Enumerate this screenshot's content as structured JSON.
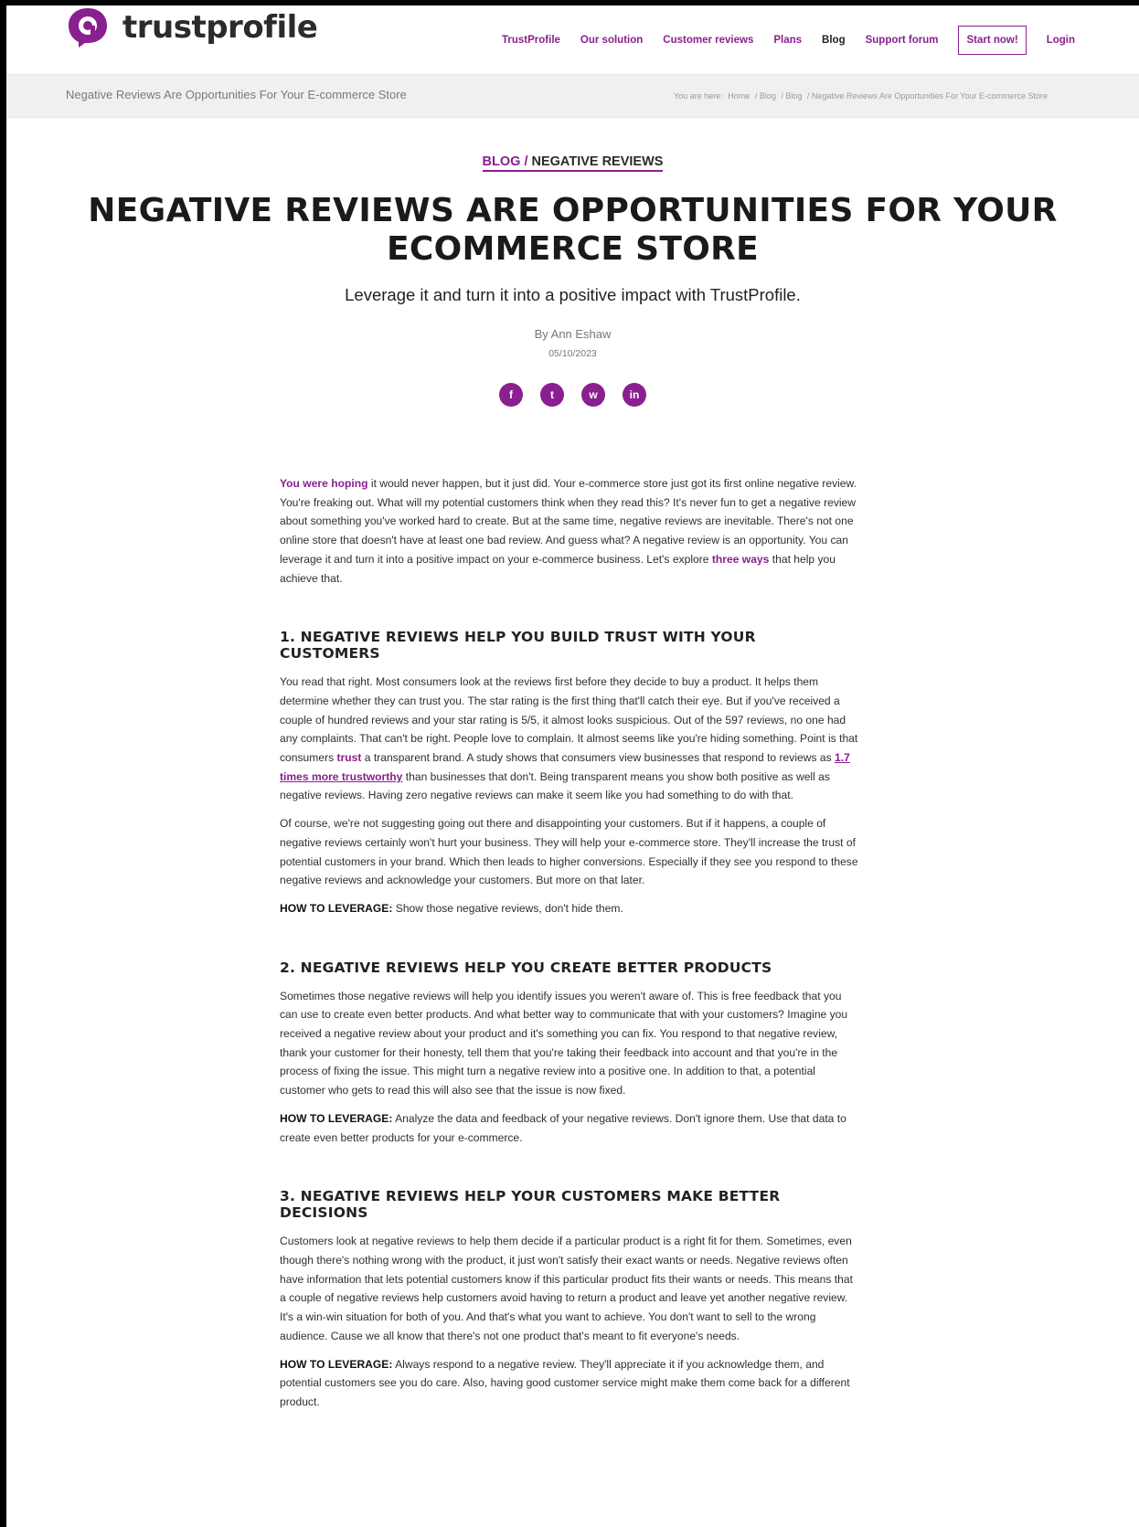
{
  "header": {
    "logo_text": "trustprofile",
    "nav": [
      "TrustProfile",
      "Our solution",
      "Customer reviews",
      "Plans",
      "Blog",
      "Support forum",
      "Start now!",
      "Login"
    ]
  },
  "subbar": {
    "title": "Negative Reviews Are Opportunities For Your E-commerce Store",
    "crumbs": [
      "You are here:",
      "Home",
      "/ Blog",
      "/ Blog",
      "/ Negative Reviews Are Opportunities For Your E-commerce Store"
    ]
  },
  "post": {
    "cat1": "BLOG /",
    "cat2": "NEGATIVE REVIEWS",
    "title": "NEGATIVE REVIEWS ARE OPPORTUNITIES FOR YOUR ECOMMERCE STORE",
    "lead": "Leverage it and turn it into a positive impact with TrustProfile.",
    "author": "By Ann Eshaw",
    "date": "05/10/2023",
    "social": [
      "f",
      "t",
      "w",
      "in"
    ]
  },
  "body": {
    "intro_hl": "You were hoping",
    "intro": " it would never happen, but it just did. Your e-commerce store just got its first online negative review. You're freaking out. What will my potential customers think when they read this? It's never fun to get a negative review about something you've worked hard to create. But at the same time, negative reviews are inevitable. There's not one online store that doesn't have at least one bad review. And guess what? A negative review is an opportunity. You can leverage it and turn it into a positive impact on your e-commerce business. Let's explore ",
    "intro_hl2": "three ways",
    "intro_end": " that help you achieve that.",
    "h1": "1. NEGATIVE REVIEWS HELP YOU BUILD TRUST WITH YOUR CUSTOMERS",
    "p1a": "You read that right. Most consumers look at the reviews first before they decide to buy a product. It helps them determine whether they can trust you. The star rating is the first thing that'll catch their eye. But if you've received a couple of hundred reviews and your star rating is 5/5, it almost looks suspicious. Out of the 597 reviews, no one had any complaints. That can't be right. People love to complain. It almost seems like you're hiding something. Point is that consumers ",
    "p1_trust": "trust",
    "p1b": " a transparent brand. A study shows that consumers view businesses that respond to reviews as ",
    "p1_link": "1.7 times more trustworthy",
    "p1c": " than businesses that don't. Being transparent means you show both positive as well as negative reviews. Having zero negative reviews can make it seem like you had something to do with that.",
    "p2": "Of course, we're not suggesting going out there and disappointing your customers. But if it happens, a couple of negative reviews certainly won't hurt your business. They will help your e-commerce store. They'll increase the trust of potential customers in your brand. Which then leads to higher conversions. Especially if they see you respond to these negative reviews and acknowledge your customers. But more on that later.",
    "lev_label": "HOW TO LEVERAGE:",
    "lev1": " Show those negative reviews, don't hide them.",
    "h2": "2. NEGATIVE REVIEWS HELP YOU CREATE BETTER PRODUCTS",
    "p3": "Sometimes those negative reviews will help you identify issues you weren't aware of. This is free feedback that you can use to create even better products. And what better way to communicate that with your customers? Imagine you received a negative review about your product and it's something you can fix. You respond to that negative review, thank your customer for their honesty, tell them that you're taking their feedback into account and that you're in the process of fixing the issue. This might turn a negative review into a positive one. In addition to that, a potential customer who gets to read this will also see that the issue is now fixed.",
    "lev2": " Analyze the data and feedback of your negative reviews. Don't ignore them. Use that data to create even better products for your e-commerce.",
    "h3": "3. NEGATIVE REVIEWS HELP YOUR CUSTOMERS MAKE BETTER DECISIONS",
    "p4": "Customers look at negative reviews to help them decide if a particular product is a right fit for them. Sometimes, even though there's nothing wrong with the product, it just won't satisfy their exact wants or needs. Negative reviews often have information that lets potential customers know if this particular product fits their wants or needs. This means that a couple of negative reviews help customers avoid having to return a product and leave yet another negative review. It's a win-win situation for both of you. And that's what you want to achieve. You don't want to sell to the wrong audience. Cause we all know that there's not one product that's meant to fit everyone's needs.",
    "lev3": " Always respond to a negative review. They'll appreciate it if you acknowledge them, and potential customers see you do care. Also, having good customer service might make them come back for a different product."
  }
}
